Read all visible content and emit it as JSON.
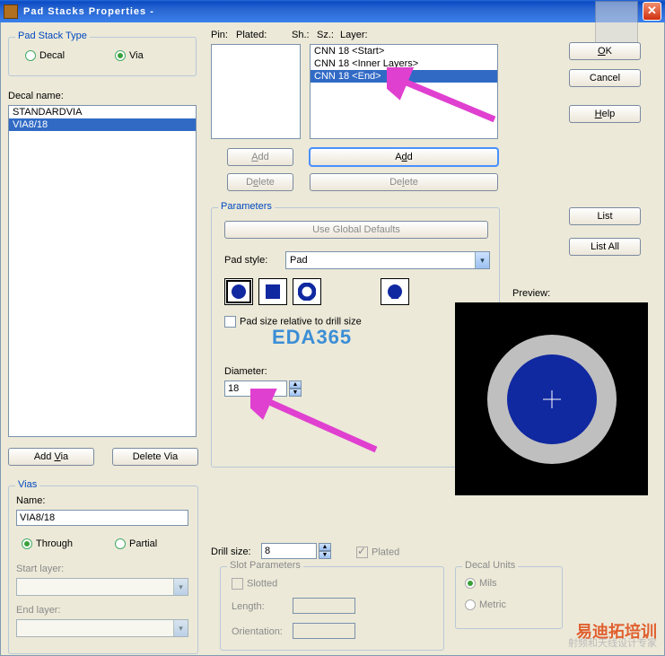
{
  "title": "Pad Stacks Properties -",
  "padStackType": {
    "label": "Pad Stack Type",
    "decal": "Decal",
    "via": "Via"
  },
  "decalName": {
    "label": "Decal name:",
    "items": [
      "STANDARDVIA",
      "VIA8/18"
    ],
    "selectedIndex": 1
  },
  "btns": {
    "addVia": "Add Via",
    "deleteVia": "Delete Via",
    "ok": "OK",
    "cancel": "Cancel",
    "help": "Help",
    "list": "List",
    "listAll": "List All",
    "add": "Add",
    "delete": "Delete",
    "useGlobal": "Use Global Defaults"
  },
  "vias": {
    "label": "Vias",
    "name": "Name:",
    "value": "VIA8/18",
    "through": "Through",
    "partial": "Partial",
    "startLayer": "Start layer:",
    "endLayer": "End layer:"
  },
  "columns": {
    "pin": "Pin:",
    "plated": "Plated:",
    "sh": "Sh.:",
    "sz": "Sz.:",
    "layer": "Layer:"
  },
  "layerList": {
    "items": [
      "CNN 18 <Start>",
      "CNN 18 <Inner Layers>",
      "CNN 18 <End>"
    ],
    "selectedIndex": 2
  },
  "parameters": {
    "label": "Parameters",
    "padStyle": "Pad style:",
    "padStyleValue": "Pad",
    "relCheck": "Pad size relative to drill size",
    "diameter": "Diameter:",
    "diameterValue": "18"
  },
  "preview": "Preview:",
  "drill": {
    "label": "Drill size:",
    "value": "8",
    "plated": "Plated"
  },
  "slot": {
    "label": "Slot Parameters",
    "slotted": "Slotted",
    "length": "Length:",
    "orientation": "Orientation:"
  },
  "decalUnits": {
    "label": "Decal Units",
    "mils": "Mils",
    "metric": "Metric"
  },
  "watermark": "EDA365",
  "logo": {
    "l1": "易迪拓培训",
    "l2": "射频和天线设计专家"
  }
}
